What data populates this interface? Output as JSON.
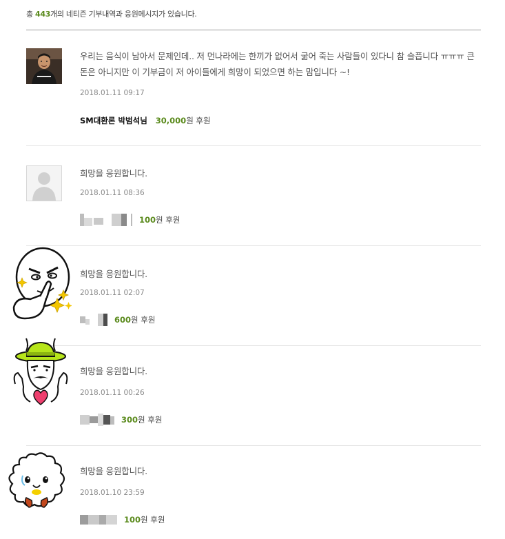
{
  "summary": {
    "prefix": "총 ",
    "count": "443",
    "suffix": "개의 네티즌 기부내역과 응원메시지가 있습니다."
  },
  "comments": [
    {
      "message": "우리는 음식이 남아서 문제인데.. 저 먼나라에는 한끼가 없어서 굶어 죽는 사람들이 있다니 참 슬픕니다 ㅠㅠㅠ 큰 돈은 아니지만 이 기부금이 저 아이들에게 희망이 되었으면 하는 맘입니다 ~!",
      "datetime": "2018.01.11 09:17",
      "donor_name": "SM대환론 박범석님",
      "amount": "30,000",
      "unit": "원 후원",
      "avatar": "profile-photo"
    },
    {
      "message": "희망을 응원합니다.",
      "datetime": "2018.01.11 08:36",
      "amount": "100",
      "unit": "원 후원",
      "avatar": "default-user-icon"
    },
    {
      "message": "희망을 응원합니다.",
      "datetime": "2018.01.11 02:07",
      "amount": "600",
      "unit": "원 후원",
      "avatar": "moon-character-sticker"
    },
    {
      "message": "희망을 응원합니다.",
      "datetime": "2018.01.11 00:26",
      "amount": "300",
      "unit": "원 후원",
      "avatar": "hat-man-heart-sticker"
    },
    {
      "message": "희망을 응원합니다.",
      "datetime": "2018.01.10 23:59",
      "amount": "100",
      "unit": "원 후원",
      "avatar": "fluffy-sheep-sticker"
    }
  ],
  "colors": {
    "accent_green": "#5a8a1c",
    "divider": "#e4e4e4",
    "top_rule": "#9a9a9a"
  }
}
